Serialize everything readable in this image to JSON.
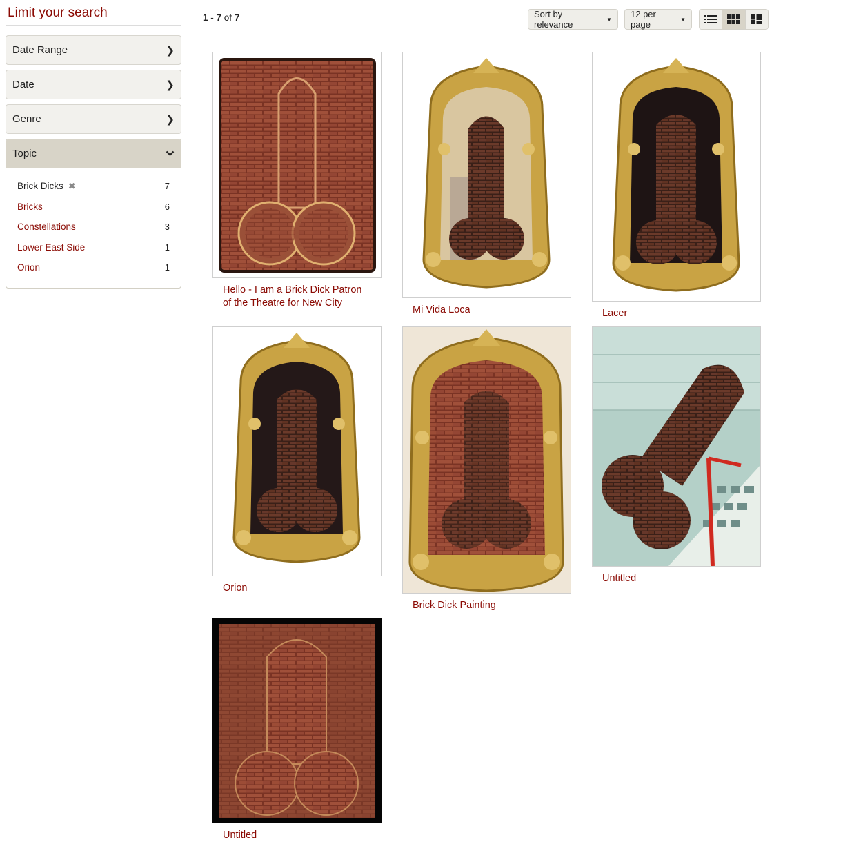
{
  "sidebar": {
    "heading": "Limit your search",
    "facets": [
      {
        "label": "Date Range",
        "icon": "chevron-right-icon"
      },
      {
        "label": "Date",
        "icon": "chevron-right-icon"
      },
      {
        "label": "Genre",
        "icon": "chevron-right-icon"
      },
      {
        "label": "Topic",
        "icon": "chevron-down-icon"
      }
    ],
    "topic_values": [
      {
        "label": "Brick Dicks",
        "count": "7",
        "selected": true
      },
      {
        "label": "Bricks",
        "count": "6"
      },
      {
        "label": "Constellations",
        "count": "3"
      },
      {
        "label": "Lower East Side",
        "count": "1"
      },
      {
        "label": "Orion",
        "count": "1"
      }
    ]
  },
  "toolbar": {
    "range_start": "1",
    "range_end": "7",
    "of_label": "of",
    "total": "7",
    "sort_label": "Sort by relevance",
    "per_page_label": "12 per page",
    "views": [
      "list-view-icon",
      "gallery-view-icon",
      "masonry-view-icon"
    ],
    "active_view": "gallery-view-icon"
  },
  "results": [
    {
      "title": "Hello - I am a Brick Dick Patron of the Theatre for New City"
    },
    {
      "title": "Mi Vida Loca"
    },
    {
      "title": "Lacer"
    },
    {
      "title": "Orion"
    },
    {
      "title": "Brick Dick Painting"
    },
    {
      "title": "Untitled"
    },
    {
      "title": "Untitled"
    }
  ],
  "colors": {
    "link": "#8b0b04",
    "facet_header": "#f2f1ed",
    "facet_open_header": "#d8d4c8",
    "gold": "#c9a344",
    "brick": "#8a3e2c"
  }
}
